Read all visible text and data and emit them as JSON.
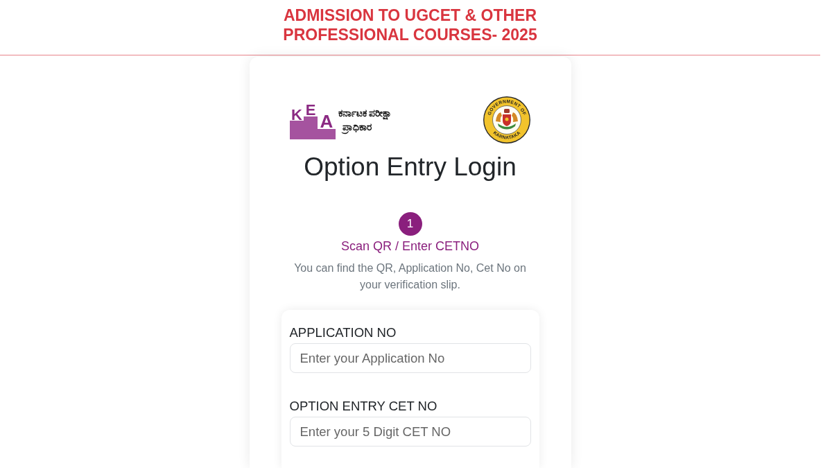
{
  "header": {
    "title": "ADMISSION TO UGCET & OTHER PROFESSIONAL COURSES- 2025"
  },
  "login_card": {
    "kea_logo": {
      "letters": [
        "K",
        "E",
        "A"
      ],
      "name_lines": [
        "ಕರ್ನಾಟಕ ಪರೀಕ್ಷಾ",
        "ಪ್ರಾಧಿಕಾರ"
      ]
    },
    "state_emblem": {
      "top_text": "GOVERNMENT OF",
      "bottom_text": "KARNATAKA"
    },
    "title": "Option Entry Login",
    "steps": [
      {
        "number": "1",
        "label": "Scan QR / Enter CETNO"
      }
    ],
    "hint": "You can find the QR, Application No, Cet No on your verification slip.",
    "form": {
      "fields": [
        {
          "label": "APPLICATION NO",
          "placeholder": "Enter your Application No"
        },
        {
          "label": "OPTION ENTRY CET NO",
          "placeholder": "Enter your 5 Digit CET NO"
        }
      ]
    }
  }
}
